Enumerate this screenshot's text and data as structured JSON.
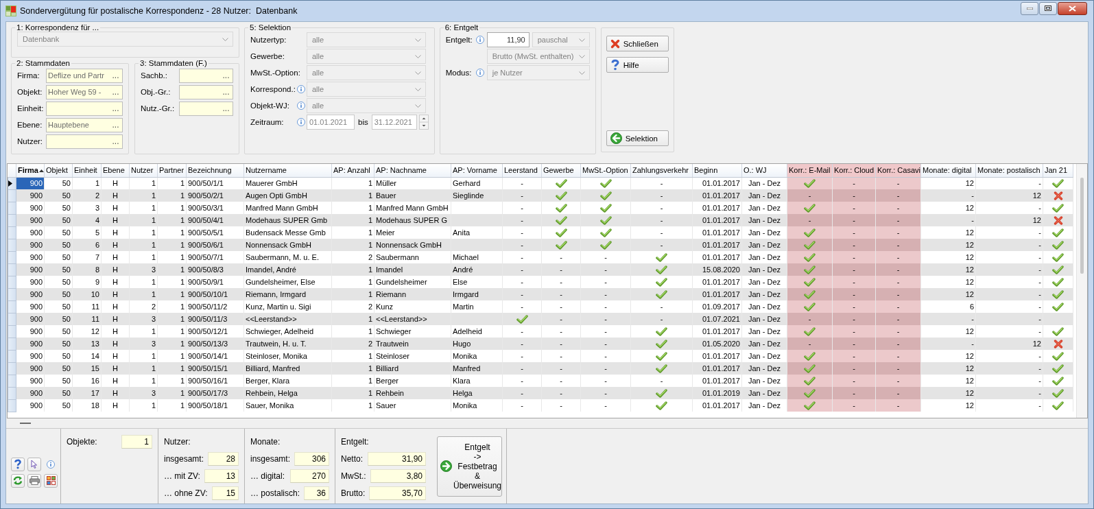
{
  "window": {
    "title": "Sondervergütung für postalische Korrespondenz - 28 Nutzer:  Datenbank"
  },
  "korrespondenz": {
    "legend": "1: Korrespondenz für ...",
    "combo": {
      "value": "Datenbank",
      "disabled": true
    }
  },
  "stammdaten": {
    "legend": "2: Stammdaten",
    "fields": [
      {
        "label": "Firma:",
        "value": "Deflize und Partr",
        "lookup": "..."
      },
      {
        "label": "Objekt:",
        "value": "Hoher Weg 59 -",
        "lookup": "..."
      },
      {
        "label": "Einheit:",
        "lookup": "..."
      },
      {
        "label": "Ebene:",
        "value": "Hauptebene",
        "lookup": "..."
      },
      {
        "label": "Nutzer:",
        "lookup": "..."
      }
    ]
  },
  "stammdaten_f": {
    "legend": "3: Stammdaten (F.)",
    "fields": [
      {
        "label": "Sachb.:",
        "lookup": "..."
      },
      {
        "label": "Obj.-Gr.:",
        "lookup": "..."
      },
      {
        "label": "Nutz.-Gr.:",
        "lookup": "..."
      }
    ]
  },
  "selektion": {
    "legend": "5: Selektion",
    "rows": [
      {
        "kind": "combo",
        "label": "Nutzertyp:",
        "info": false,
        "combo": {
          "value": "alle",
          "disabled": true
        }
      },
      {
        "kind": "combo",
        "label": "Gewerbe:",
        "info": false,
        "combo": {
          "value": "alle",
          "disabled": true
        }
      },
      {
        "kind": "combo",
        "label": "MwSt.-Option:",
        "info": false,
        "combo": {
          "value": "alle",
          "disabled": true
        }
      },
      {
        "kind": "combo",
        "label": "Korrespond.:",
        "info": true,
        "combo": {
          "value": "alle",
          "disabled": true
        }
      },
      {
        "kind": "combo",
        "label": "Objekt-WJ:",
        "info": true,
        "combo": {
          "value": "alle",
          "disabled": true
        }
      },
      {
        "kind": "range",
        "label": "Zeitraum:",
        "info": true,
        "from": "01.01.2021",
        "between": "bis",
        "to": "31.12.2021"
      }
    ]
  },
  "entgelt": {
    "legend": "6: Entgelt",
    "rows": [
      {
        "kind": "amount",
        "label": "Entgelt:",
        "info": true,
        "amount": "11,90",
        "combo": {
          "value": "pauschal",
          "disabled": true
        }
      },
      {
        "kind": "combo",
        "combo": {
          "value": "Brutto (MwSt. enthalten)",
          "disabled": true
        }
      },
      {
        "kind": "combo",
        "label": "Modus:",
        "info": true,
        "combo": {
          "value": "je Nutzer",
          "disabled": true
        }
      }
    ]
  },
  "buttons": [
    {
      "label": "Schließen",
      "kind": "close"
    },
    {
      "label": "Hilfe",
      "kind": "help"
    },
    {
      "label": "Selektion",
      "kind": "back"
    }
  ],
  "table": {
    "columns": [
      {
        "label": "Firma",
        "kind": "number",
        "sorted": true,
        "highlight": false
      },
      {
        "label": "Objekt",
        "kind": "number",
        "sorted": false,
        "highlight": false
      },
      {
        "label": "Einheit",
        "kind": "number",
        "sorted": false,
        "highlight": false
      },
      {
        "label": "Ebene",
        "kind": "center",
        "sorted": false,
        "highlight": false
      },
      {
        "label": "Nutzer",
        "kind": "number",
        "sorted": false,
        "highlight": false
      },
      {
        "label": "Partner",
        "kind": "number",
        "sorted": false,
        "highlight": false
      },
      {
        "label": "Bezeichnung",
        "kind": "text",
        "sorted": false,
        "highlight": false
      },
      {
        "label": "Nutzername",
        "kind": "text",
        "sorted": false,
        "highlight": false
      },
      {
        "label": "AP: Anzahl",
        "kind": "number",
        "sorted": false,
        "highlight": false
      },
      {
        "label": "AP: Nachname",
        "kind": "text",
        "sorted": false,
        "highlight": false
      },
      {
        "label": "AP: Vorname",
        "kind": "text",
        "sorted": false,
        "highlight": false
      },
      {
        "label": "Leerstand",
        "kind": "mark",
        "sorted": false,
        "highlight": false
      },
      {
        "label": "Gewerbe",
        "kind": "mark",
        "sorted": false,
        "highlight": false
      },
      {
        "label": "MwSt.-Option",
        "kind": "mark",
        "sorted": false,
        "highlight": false
      },
      {
        "label": "Zahlungsverkehr",
        "kind": "mark",
        "sorted": false,
        "highlight": false
      },
      {
        "label": "Beginn",
        "kind": "number",
        "sorted": false,
        "highlight": false
      },
      {
        "label": "O.: WJ",
        "kind": "center",
        "sorted": false,
        "highlight": false
      },
      {
        "label": "Korr.: E-Mail",
        "kind": "mark",
        "sorted": false,
        "highlight": true
      },
      {
        "label": "Korr.: Cloud",
        "kind": "mark",
        "sorted": false,
        "highlight": true
      },
      {
        "label": "Korr.: Casavi",
        "kind": "mark",
        "sorted": false,
        "highlight": true
      },
      {
        "label": "Monate: digital",
        "kind": "number",
        "sorted": false,
        "highlight": false
      },
      {
        "label": "Monate: postalisch",
        "kind": "number",
        "sorted": false,
        "highlight": false
      },
      {
        "label": "Jan 21",
        "kind": "mark",
        "sorted": false,
        "highlight": false
      }
    ],
    "rows": [
      {
        "selected": true,
        "cells": [
          "900",
          "50",
          "1",
          "H",
          "1",
          "1",
          "900/50/1/1",
          "Mauerer GmbH",
          "1",
          "Müller",
          "Gerhard",
          "-",
          true,
          true,
          "-",
          "01.01.2017",
          "Jan - Dez",
          true,
          "-",
          "-",
          "12",
          "-",
          true
        ]
      },
      {
        "selected": false,
        "cells": [
          "900",
          "50",
          "2",
          "H",
          "1",
          "1",
          "900/50/2/1",
          "Augen Opti GmbH",
          "1",
          "Bauer",
          "Sieglinde",
          "-",
          true,
          true,
          "-",
          "01.01.2017",
          "Jan - Dez",
          "-",
          "-",
          "-",
          "-",
          "12",
          false
        ]
      },
      {
        "selected": false,
        "cells": [
          "900",
          "50",
          "3",
          "H",
          "1",
          "1",
          "900/50/3/1",
          "Manfred Mann GmbH",
          "1",
          "Manfred Mann GmbH",
          null,
          "-",
          true,
          true,
          "-",
          "01.01.2017",
          "Jan - Dez",
          true,
          "-",
          "-",
          "12",
          "-",
          true
        ]
      },
      {
        "selected": false,
        "cells": [
          "900",
          "50",
          "4",
          "H",
          "1",
          "1",
          "900/50/4/1",
          "Modehaus SUPER Gmb",
          "1",
          "Modehaus SUPER G",
          null,
          "-",
          true,
          true,
          "-",
          "01.01.2017",
          "Jan - Dez",
          "-",
          "-",
          "-",
          "-",
          "12",
          false
        ]
      },
      {
        "selected": false,
        "cells": [
          "900",
          "50",
          "5",
          "H",
          "1",
          "1",
          "900/50/5/1",
          "Budensack Messe Gmb",
          "1",
          "Meier",
          "Anita",
          "-",
          true,
          true,
          "-",
          "01.01.2017",
          "Jan - Dez",
          true,
          "-",
          "-",
          "12",
          "-",
          true
        ]
      },
      {
        "selected": false,
        "cells": [
          "900",
          "50",
          "6",
          "H",
          "1",
          "1",
          "900/50/6/1",
          "Nonnensack GmbH",
          "1",
          "Nonnensack GmbH",
          null,
          "-",
          true,
          true,
          "-",
          "01.01.2017",
          "Jan - Dez",
          true,
          "-",
          "-",
          "12",
          "-",
          true
        ]
      },
      {
        "selected": false,
        "cells": [
          "900",
          "50",
          "7",
          "H",
          "1",
          "1",
          "900/50/7/1",
          "Saubermann, M. u. E.",
          "2",
          "Saubermann",
          "Michael",
          "-",
          "-",
          "-",
          true,
          "01.01.2017",
          "Jan - Dez",
          true,
          "-",
          "-",
          "12",
          "-",
          true
        ]
      },
      {
        "selected": false,
        "cells": [
          "900",
          "50",
          "8",
          "H",
          "3",
          "1",
          "900/50/8/3",
          "Imandel, André",
          "1",
          "Imandel",
          "André",
          "-",
          "-",
          "-",
          true,
          "15.08.2020",
          "Jan - Dez",
          true,
          "-",
          "-",
          "12",
          "-",
          true
        ]
      },
      {
        "selected": false,
        "cells": [
          "900",
          "50",
          "9",
          "H",
          "1",
          "1",
          "900/50/9/1",
          "Gundelsheimer, Else",
          "1",
          "Gundelsheimer",
          "Else",
          "-",
          "-",
          "-",
          true,
          "01.01.2017",
          "Jan - Dez",
          true,
          "-",
          "-",
          "12",
          "-",
          true
        ]
      },
      {
        "selected": false,
        "cells": [
          "900",
          "50",
          "10",
          "H",
          "1",
          "1",
          "900/50/10/1",
          "Riemann, Irmgard",
          "1",
          "Riemann",
          "Irmgard",
          "-",
          "-",
          "-",
          true,
          "01.01.2017",
          "Jan - Dez",
          true,
          "-",
          "-",
          "12",
          "-",
          true
        ]
      },
      {
        "selected": false,
        "cells": [
          "900",
          "50",
          "11",
          "H",
          "2",
          "1",
          "900/50/11/2",
          "Kunz, Martin u. Sigi",
          "2",
          "Kunz",
          "Martin",
          "-",
          "-",
          "-",
          "-",
          "01.09.2017",
          "Jan - Dez",
          true,
          "-",
          "-",
          "6",
          "-",
          true
        ]
      },
      {
        "selected": false,
        "cells": [
          "900",
          "50",
          "11",
          "H",
          "3",
          "1",
          "900/50/11/3",
          "<<Leerstand>>",
          "1",
          "<<Leerstand>>",
          null,
          true,
          "-",
          "-",
          "-",
          "01.07.2021",
          "Jan - Dez",
          "-",
          "-",
          "-",
          "-",
          "-",
          null
        ]
      },
      {
        "selected": false,
        "cells": [
          "900",
          "50",
          "12",
          "H",
          "1",
          "1",
          "900/50/12/1",
          "Schwieger, Adelheid",
          "1",
          "Schwieger",
          "Adelheid",
          "-",
          "-",
          "-",
          true,
          "01.01.2017",
          "Jan - Dez",
          true,
          "-",
          "-",
          "12",
          "-",
          true
        ]
      },
      {
        "selected": false,
        "cells": [
          "900",
          "50",
          "13",
          "H",
          "3",
          "1",
          "900/50/13/3",
          "Trautwein, H. u. T.",
          "2",
          "Trautwein",
          "Hugo",
          "-",
          "-",
          "-",
          true,
          "01.05.2020",
          "Jan - Dez",
          "-",
          "-",
          "-",
          "-",
          "12",
          false
        ]
      },
      {
        "selected": false,
        "cells": [
          "900",
          "50",
          "14",
          "H",
          "1",
          "1",
          "900/50/14/1",
          "Steinloser, Monika",
          "1",
          "Steinloser",
          "Monika",
          "-",
          "-",
          "-",
          true,
          "01.01.2017",
          "Jan - Dez",
          true,
          "-",
          "-",
          "12",
          "-",
          true
        ]
      },
      {
        "selected": false,
        "cells": [
          "900",
          "50",
          "15",
          "H",
          "1",
          "1",
          "900/50/15/1",
          "Billiard, Manfred",
          "1",
          "Billiard",
          "Manfred",
          "-",
          "-",
          "-",
          true,
          "01.01.2017",
          "Jan - Dez",
          true,
          "-",
          "-",
          "12",
          "-",
          true
        ]
      },
      {
        "selected": false,
        "cells": [
          "900",
          "50",
          "16",
          "H",
          "1",
          "1",
          "900/50/16/1",
          "Berger, Klara",
          "1",
          "Berger",
          "Klara",
          "-",
          "-",
          "-",
          "-",
          "01.01.2017",
          "Jan - Dez",
          true,
          "-",
          "-",
          "12",
          "-",
          true
        ]
      },
      {
        "selected": false,
        "cells": [
          "900",
          "50",
          "17",
          "H",
          "3",
          "1",
          "900/50/17/3",
          "Rehbein, Helga",
          "1",
          "Rehbein",
          "Helga",
          "-",
          "-",
          "-",
          true,
          "01.01.2019",
          "Jan - Dez",
          true,
          "-",
          "-",
          "12",
          "-",
          true
        ]
      },
      {
        "selected": false,
        "cells": [
          "900",
          "50",
          "18",
          "H",
          "1",
          "1",
          "900/50/18/1",
          "Sauer, Monika",
          "1",
          "Sauer",
          "Monika",
          "-",
          "-",
          "-",
          true,
          "01.01.2017",
          "Jan - Dez",
          true,
          "-",
          "-",
          "12",
          "-",
          true
        ]
      }
    ]
  },
  "summary": {
    "objekte": {
      "label": "Objekte:",
      "value": "1"
    },
    "nutzer": {
      "title": "Nutzer:",
      "rows": [
        {
          "label": "insgesamt:",
          "value": "28"
        },
        {
          "label": "… mit ZV:",
          "value": "13"
        },
        {
          "label": "… ohne ZV:",
          "value": "15"
        }
      ]
    },
    "monate": {
      "title": "Monate:",
      "rows": [
        {
          "label": "insgesamt:",
          "value": "306"
        },
        {
          "label": "… digital:",
          "value": "270"
        },
        {
          "label": "… postalisch:",
          "value": "36"
        }
      ]
    },
    "entgelt": {
      "title": "Entgelt:",
      "rows": [
        {
          "label": "Netto:",
          "value": "31,90"
        },
        {
          "label": "MwSt.:",
          "value": "3,80"
        },
        {
          "label": "Brutto:",
          "value": "35,70"
        }
      ]
    },
    "action": {
      "label": "Entgelt\n->\nFestbetrag\n&\nÜberweisung"
    }
  }
}
